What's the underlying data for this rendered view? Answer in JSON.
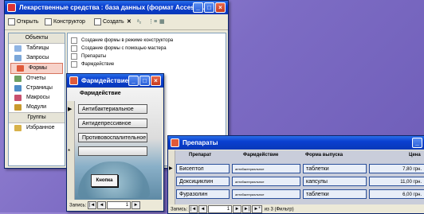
{
  "db_window": {
    "title": "Лекарственные средства : база данных (формат Access ...",
    "toolbar": {
      "open": "Открыть",
      "design": "Конструктор",
      "create": "Создать",
      "delete": "✕"
    },
    "objects_title": "Объекты",
    "objects": [
      "Таблицы",
      "Запросы",
      "Формы",
      "Отчеты",
      "Страницы",
      "Макросы",
      "Модули"
    ],
    "groups_title": "Группы",
    "groups": [
      "Избранное"
    ],
    "list": [
      "Создание формы в режиме конструктора",
      "Создание формы с помощью мастера",
      "Препараты",
      "Фармдействие"
    ]
  },
  "pharm_form": {
    "title": "Фармдействие",
    "field_header": "Фармдействие",
    "records": [
      "Антибактериальное",
      "Антидепрессивное",
      "Противовоспалительное"
    ],
    "button_label": "Кнопка",
    "nav": {
      "record_label": "Запись:",
      "nav_first": "|◄",
      "nav_prev": "◄",
      "current": "1",
      "nav_next": "►"
    }
  },
  "prep_window": {
    "title": "Препараты",
    "columns": [
      "Препарат",
      "Фармдействие",
      "Форма выпуска",
      "Цена"
    ],
    "rows": [
      [
        "Бисептол",
        "антибактериальное",
        "таблетки",
        "7,80 грн."
      ],
      [
        "Доксициклин",
        "антибактериальное",
        "капсулы",
        "11,00 грн."
      ],
      [
        "Фуразолин",
        "антибактериальное",
        "таблетки",
        "6,00 грн."
      ]
    ],
    "nav": {
      "record_label": "Запись:",
      "nav_first": "|◄",
      "nav_prev": "◄",
      "current": "1",
      "nav_next": "►",
      "nav_last": "►|",
      "nav_new": "►*",
      "count": "из 3 (Фильтр)"
    }
  }
}
